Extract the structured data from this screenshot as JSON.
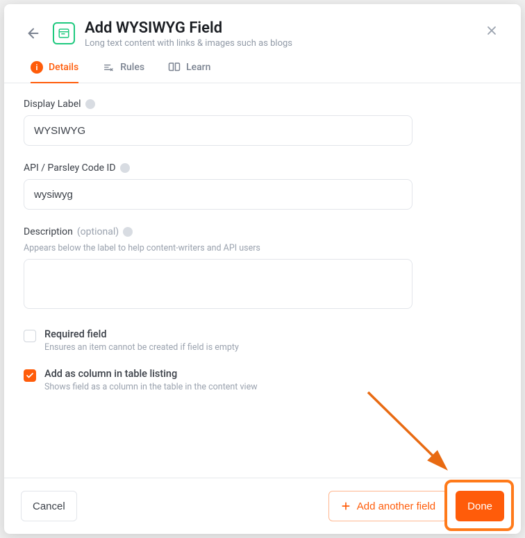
{
  "header": {
    "title": "Add WYSIWYG Field",
    "subtitle": "Long text content with links & images such as blogs"
  },
  "tabs": [
    {
      "label": "Details",
      "active": true
    },
    {
      "label": "Rules",
      "active": false
    },
    {
      "label": "Learn",
      "active": false
    }
  ],
  "fields": {
    "display_label": {
      "label": "Display Label",
      "value": "WYSIWYG"
    },
    "code_id": {
      "label": "API / Parsley Code ID",
      "value": "wysiwyg"
    },
    "description": {
      "label": "Description",
      "optional": "(optional)",
      "hint": "Appears below the label to help content-writers and API users",
      "value": ""
    }
  },
  "options": {
    "required": {
      "label": "Required field",
      "hint": "Ensures an item cannot be created if field is empty",
      "checked": false
    },
    "add_column": {
      "label": "Add as column in table listing",
      "hint": "Shows field as a column in the table in the content view",
      "checked": true
    }
  },
  "footer": {
    "cancel": "Cancel",
    "add_another": "Add another field",
    "done": "Done"
  }
}
